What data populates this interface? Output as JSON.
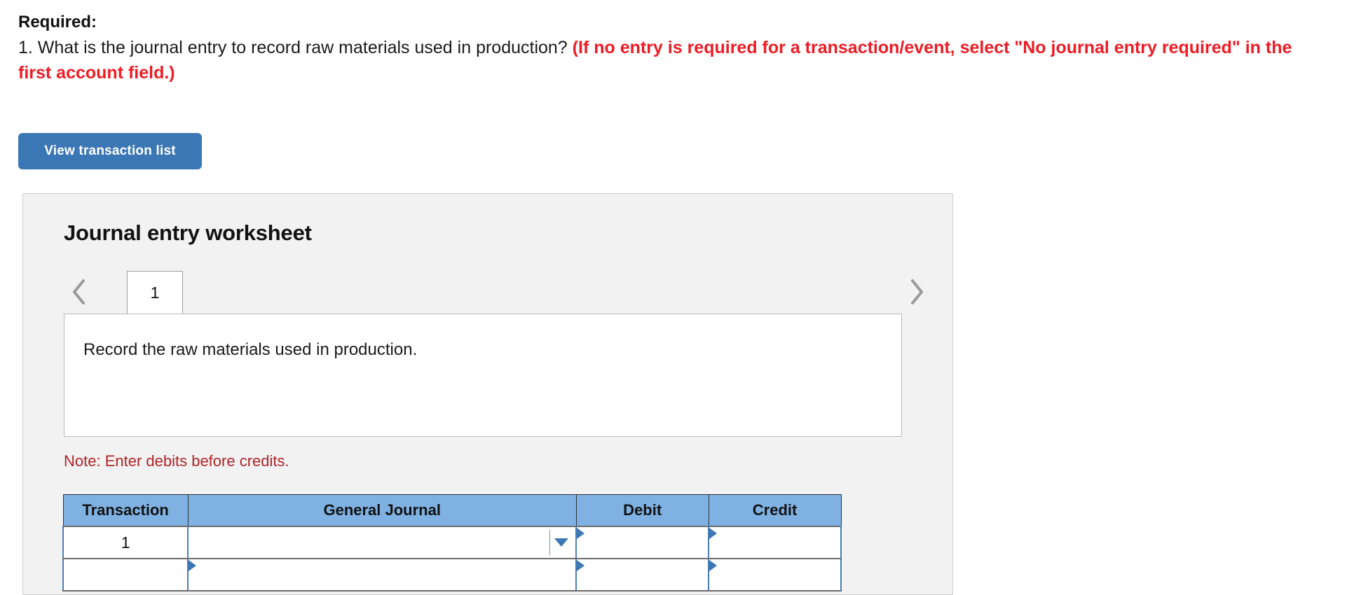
{
  "question": {
    "required_label": "Required:",
    "line_prefix": "1. What is the journal entry to record raw materials used in production? ",
    "line_emphasis": "(If no entry is required for a transaction/event, select \"No journal entry required\" in the first account field.)"
  },
  "toolbar": {
    "view_transaction_list_label": "View transaction list"
  },
  "worksheet": {
    "title": "Journal entry worksheet",
    "prev_icon": "chevron-left-icon",
    "next_icon": "chevron-right-icon",
    "tabs": [
      {
        "label": "1",
        "active": true
      }
    ],
    "entry_description": "Record the raw materials used in production.",
    "note": "Note: Enter debits before credits.",
    "table": {
      "columns": [
        "Transaction",
        "General Journal",
        "Debit",
        "Credit"
      ],
      "rows": [
        {
          "transaction": "1",
          "general_journal": "",
          "debit": "",
          "credit": "",
          "general_journal_active": true,
          "general_journal_icon": "dropdown-caret-icon"
        },
        {
          "transaction": "",
          "general_journal": "",
          "debit": "",
          "credit": "",
          "general_journal_active": false
        }
      ]
    }
  },
  "colors": {
    "button_blue": "#3c77b5",
    "header_blue": "#7fb2e3",
    "emphasis_red": "#ee1c25",
    "note_red": "#b02428",
    "panel_gray": "#f2f2f2",
    "cell_border_blue": "#4a7fb5"
  }
}
